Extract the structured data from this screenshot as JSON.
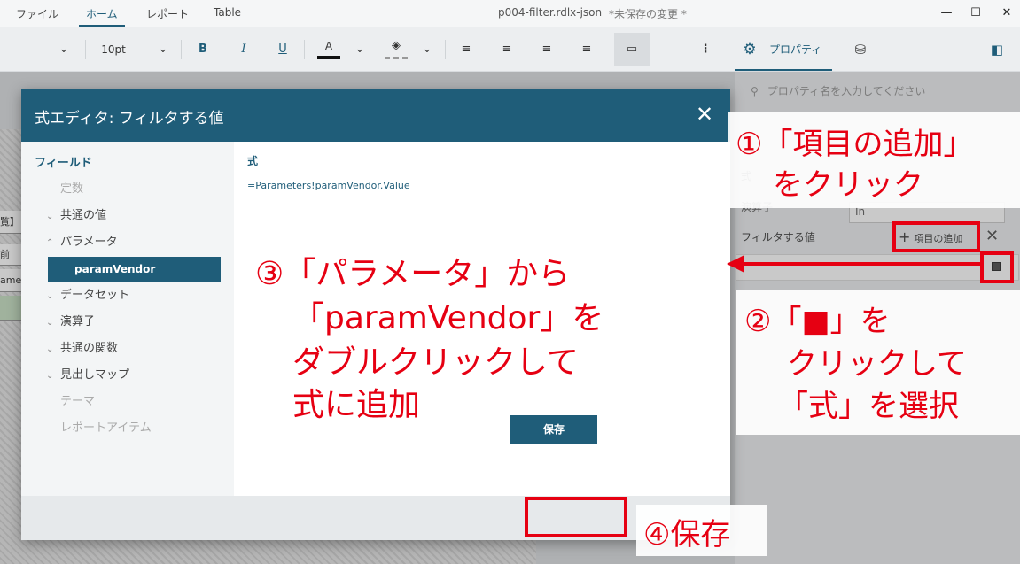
{
  "menu": {
    "file": "ファイル",
    "home": "ホーム",
    "report": "レポート",
    "table": "Table"
  },
  "doc": {
    "title": "p004-filter.rdlx-json",
    "unsaved": "*未保存の変更 *"
  },
  "toolbar": {
    "font_size": "10pt",
    "bold": "B",
    "italic": "I",
    "underline": "U",
    "font_color": "A",
    "properties_tab": "プロパティ"
  },
  "props": {
    "search_placeholder": "プロパティ名を入力してください",
    "expr_label": "式",
    "operator_label": "演算子",
    "operator_value": "In",
    "filter_value_label": "フィルタする値",
    "add_item": "項目の追加"
  },
  "report_rows": [
    "覧】",
    "前",
    "ame]"
  ],
  "dialog": {
    "title": "式エディタ: フィルタする値",
    "fields_header": "フィールド",
    "tree": [
      {
        "label": "定数",
        "expandable": false,
        "disabled": true
      },
      {
        "label": "共通の値",
        "expandable": true,
        "expanded": false
      },
      {
        "label": "パラメータ",
        "expandable": true,
        "expanded": true
      },
      {
        "label": "データセット",
        "expandable": true,
        "expanded": false
      },
      {
        "label": "演算子",
        "expandable": true,
        "expanded": false
      },
      {
        "label": "共通の関数",
        "expandable": true,
        "expanded": false
      },
      {
        "label": "見出しマップ",
        "expandable": true,
        "expanded": false
      },
      {
        "label": "テーマ",
        "expandable": false,
        "disabled": true
      },
      {
        "label": "レポートアイテム",
        "expandable": false,
        "disabled": true
      }
    ],
    "selected_param": "paramVendor",
    "expr_label": "式",
    "expression": "=Parameters!paramVendor.Value",
    "save": "保存"
  },
  "annotations": {
    "a1_line1": "①「項目の追加」",
    "a1_line2": "をクリック",
    "a2_line1": "②「■」を",
    "a2_line2": "クリックして",
    "a2_line3": "「式」を選択",
    "a3_line1": "③「パラメータ」から",
    "a3_line2": "「paramVendor」を",
    "a3_line3": "ダブルクリックして",
    "a3_line4": "式に追加",
    "a4": "④保存"
  },
  "colors": {
    "accent": "#1f5d79",
    "annotation_red": "#e60012"
  }
}
